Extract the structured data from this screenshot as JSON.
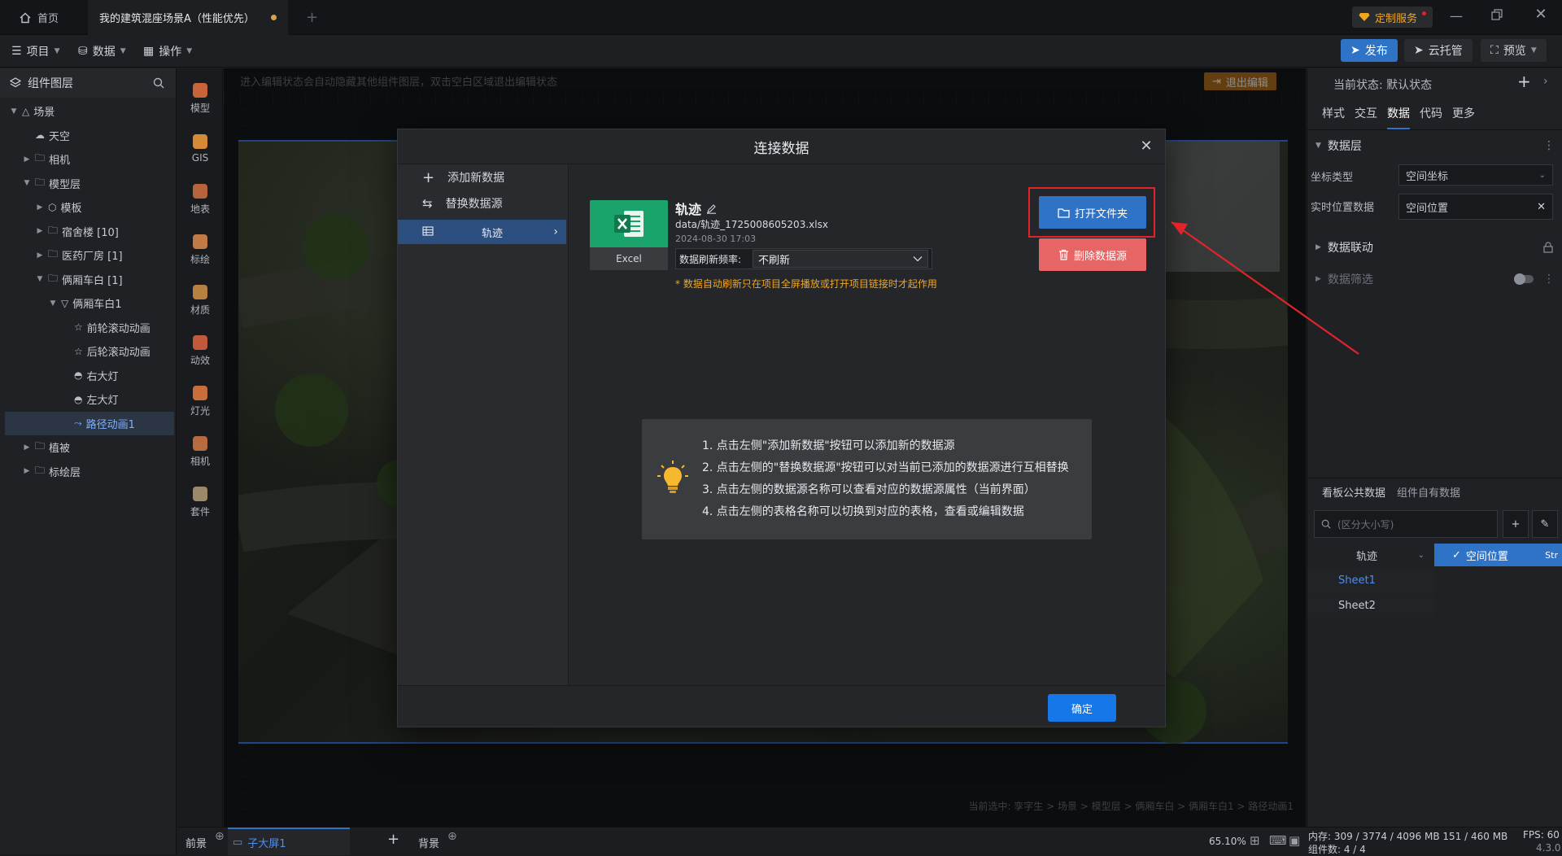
{
  "titlebar": {
    "home_tab": "首页",
    "project_tab": "我的建筑混座场景A（性能优先）",
    "custom_service": "定制服务"
  },
  "menubar": {
    "project": "项目",
    "data": "数据",
    "operate": "操作",
    "publish": "发布",
    "cloud": "云托管",
    "preview": "预览"
  },
  "layers": {
    "title": "组件图层",
    "items": [
      {
        "label": "场景",
        "depth": 0,
        "expanded": true
      },
      {
        "label": "天空",
        "depth": 1
      },
      {
        "label": "相机",
        "depth": 1
      },
      {
        "label": "模型层",
        "depth": 1,
        "expanded": true
      },
      {
        "label": "模板",
        "depth": 2
      },
      {
        "label": "宿舍楼 [10]",
        "depth": 2
      },
      {
        "label": "医药厂房 [1]",
        "depth": 2
      },
      {
        "label": "俩厢车白 [1]",
        "depth": 2,
        "expanded": true
      },
      {
        "label": "俩厢车白1",
        "depth": 3,
        "expanded": true
      },
      {
        "label": "前轮滚动动画",
        "depth": 4
      },
      {
        "label": "后轮滚动动画",
        "depth": 4
      },
      {
        "label": "右大灯",
        "depth": 4
      },
      {
        "label": "左大灯",
        "depth": 4
      },
      {
        "label": "路径动画1",
        "depth": 4,
        "selected": true
      },
      {
        "label": "植被",
        "depth": 1
      },
      {
        "label": "标绘层",
        "depth": 1
      }
    ]
  },
  "tools": [
    "模型",
    "GIS",
    "地表",
    "标绘",
    "材质",
    "动效",
    "灯光",
    "相机",
    "套件"
  ],
  "canvas": {
    "hint": "进入编辑状态会自动隐藏其他组件图层，双击空白区域退出编辑状态",
    "exit_edit": "退出编辑",
    "breadcrumb": "当前选中: 孪字生 > 场景 > 模型层 > 俩厢车白 > 俩厢车白1 > 路径动画1"
  },
  "modal": {
    "title": "连接数据",
    "add_data": "添加新数据",
    "replace_source": "替换数据源",
    "selected_source": "轨迹",
    "file_type": "Excel",
    "source_name": "轨迹",
    "source_path": "data/轨迹_1725008605203.xlsx",
    "source_date": "2024-08-30 17:03",
    "refresh_label": "数据刷新频率:",
    "refresh_value": "不刷新",
    "refresh_note": "* 数据自动刷新只在项目全屏播放或打开项目链接时才起作用",
    "open_folder": "打开文件夹",
    "delete_source": "删除数据源",
    "tips": [
      "1. 点击左侧\"添加新数据\"按钮可以添加新的数据源",
      "2. 点击左侧的\"替换数据源\"按钮可以对当前已添加的数据源进行互相替换",
      "3. 点击左侧的数据源名称可以查看对应的数据源属性（当前界面）",
      "4. 点击左侧的表格名称可以切换到对应的表格，查看或编辑数据"
    ],
    "ok": "确定"
  },
  "right_panel": {
    "state_label": "当前状态: 默认状态",
    "tabs": [
      "样式",
      "交互",
      "数据",
      "代码",
      "更多"
    ],
    "active_tab": "数据",
    "data_layer": "数据层",
    "coord_type_label": "坐标类型",
    "coord_type_value": "空间坐标",
    "realtime_label": "实时位置数据",
    "realtime_value": "空间位置",
    "data_link": "数据联动",
    "data_filter": "数据筛选",
    "public_data_tab": "看板公共数据",
    "own_data_tab": "组件自有数据",
    "search_placeholder": "(区分大小写)",
    "source_select": "轨迹",
    "field_tag": "空间位置",
    "field_tag_more": "Str",
    "sheets": [
      "Sheet1",
      "Sheet2"
    ]
  },
  "bottom": {
    "front": "前景",
    "sub_screen": "子大屏1",
    "back": "背景",
    "zoom": "65.10%"
  },
  "status": {
    "memory": "内存: 309 / 3774 / 4096 MB  151 / 460 MB",
    "fps": "FPS: 60",
    "components": "组件数: 4 / 4",
    "version": "4.3.0"
  },
  "colors": {
    "accent": "#1677e8",
    "danger": "#e66666",
    "warn": "#f0a61e",
    "excel": "#1aa36b",
    "highlight": "#e2232a"
  }
}
